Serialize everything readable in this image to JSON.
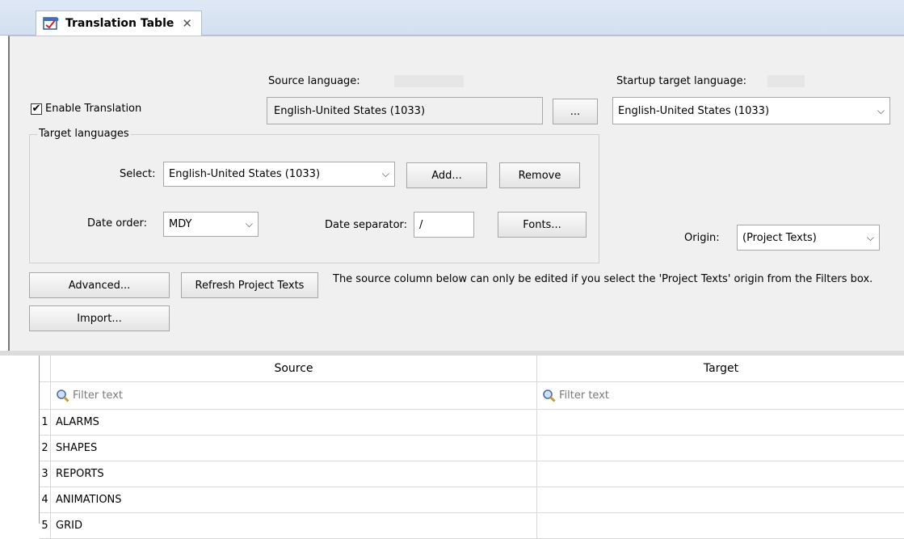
{
  "tab": {
    "title": "Translation Table",
    "close_glyph": "✕",
    "icon": "translation-table-icon"
  },
  "settings": {
    "enable_translation": {
      "label": "Enable Translation",
      "checked": true
    },
    "source_language": {
      "label": "Source language:",
      "value": "English-United States (1033)",
      "browse_label": "..."
    },
    "startup_target_language": {
      "label": "Startup target language:",
      "value": "English-United States (1033)"
    },
    "target_languages": {
      "title": "Target languages",
      "select_label": "Select:",
      "select_value": "English-United States (1033)",
      "add_label": "Add...",
      "remove_label": "Remove",
      "date_order_label": "Date order:",
      "date_order_value": "MDY",
      "date_separator_label": "Date separator:",
      "date_separator_value": "/",
      "fonts_label": "Fonts..."
    },
    "origin": {
      "label": "Origin:",
      "value": "(Project Texts)"
    },
    "advanced_label": "Advanced...",
    "refresh_label": "Refresh Project Texts",
    "import_label": "Import...",
    "note": "The source column below can only be edited if you select the 'Project Texts' origin from the Filters box."
  },
  "grid": {
    "headers": {
      "source": "Source",
      "target": "Target"
    },
    "filter_placeholder": "Filter text",
    "rows": [
      {
        "n": "1",
        "source": "ALARMS",
        "target": ""
      },
      {
        "n": "2",
        "source": "SHAPES",
        "target": ""
      },
      {
        "n": "3",
        "source": "REPORTS",
        "target": ""
      },
      {
        "n": "4",
        "source": "ANIMATIONS",
        "target": ""
      },
      {
        "n": "5",
        "source": "GRID",
        "target": ""
      }
    ]
  },
  "colors": {
    "tab_bg": "#d3dff0",
    "panel_bg": "#f0f0f0",
    "grid_line": "#d8d8d8"
  }
}
